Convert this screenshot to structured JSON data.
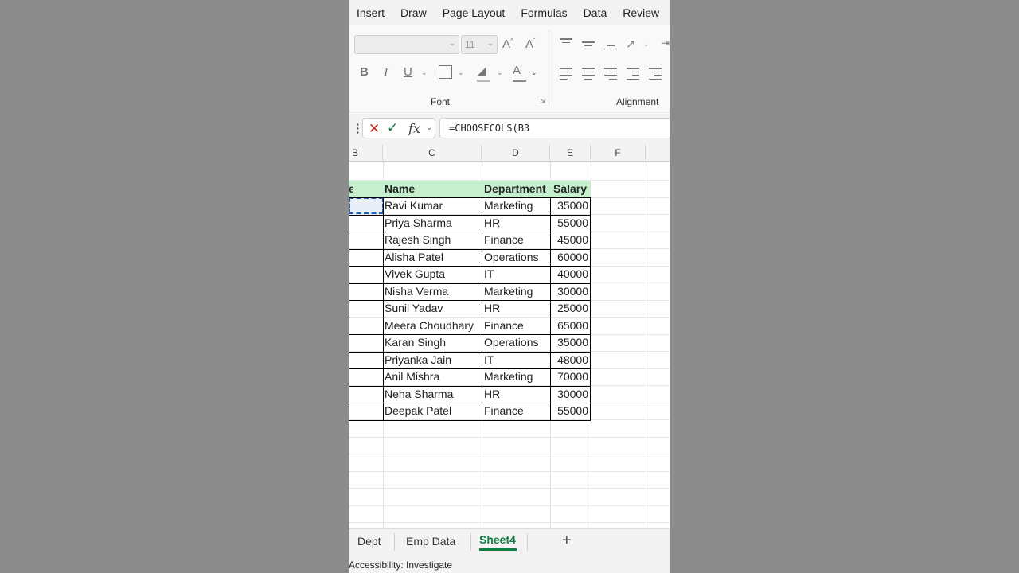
{
  "ribbon_tabs": [
    "Insert",
    "Draw",
    "Page Layout",
    "Formulas",
    "Data",
    "Review"
  ],
  "font": {
    "size": "11",
    "group_label": "Font"
  },
  "alignment": {
    "group_label": "Alignment"
  },
  "formula_bar": {
    "fx": "fx",
    "formula": "=CHOOSECOLS(B3"
  },
  "columns": [
    "B",
    "C",
    "D",
    "E",
    "F"
  ],
  "table": {
    "cut_header": "e",
    "headers": [
      "Name",
      "Department",
      "Salary"
    ],
    "rows": [
      {
        "name": "Ravi Kumar",
        "dept": "Marketing",
        "salary": "35000"
      },
      {
        "name": "Priya Sharma",
        "dept": "HR",
        "salary": "55000"
      },
      {
        "name": "Rajesh Singh",
        "dept": "Finance",
        "salary": "45000"
      },
      {
        "name": "Alisha Patel",
        "dept": "Operations",
        "salary": "60000"
      },
      {
        "name": "Vivek Gupta",
        "dept": "IT",
        "salary": "40000"
      },
      {
        "name": "Nisha Verma",
        "dept": "Marketing",
        "salary": "30000"
      },
      {
        "name": "Sunil Yadav",
        "dept": "HR",
        "salary": "25000"
      },
      {
        "name": "Meera Choudhary",
        "dept": "Finance",
        "salary": "65000"
      },
      {
        "name": "Karan Singh",
        "dept": "Operations",
        "salary": "35000"
      },
      {
        "name": "Priyanka Jain",
        "dept": "IT",
        "salary": "48000"
      },
      {
        "name": "Anil Mishra",
        "dept": "Marketing",
        "salary": "70000"
      },
      {
        "name": "Neha Sharma",
        "dept": "HR",
        "salary": "30000"
      },
      {
        "name": "Deepak Patel",
        "dept": "Finance",
        "salary": "55000"
      }
    ]
  },
  "sheet_tabs": [
    "Dept",
    "Emp Data",
    "Sheet4"
  ],
  "active_sheet": "Sheet4",
  "add_sheet": "+",
  "status": "Accessibility: Investigate",
  "colors": {
    "header_fill": "#c6efce",
    "accent": "#107c41",
    "cancel": "#c42b1c"
  }
}
